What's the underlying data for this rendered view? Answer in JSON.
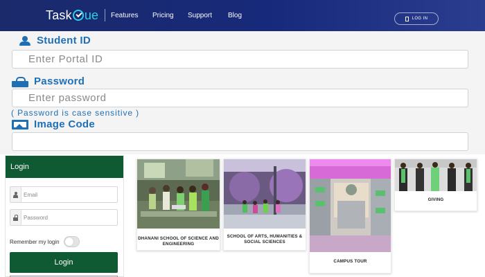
{
  "header": {
    "logo": {
      "part1": "Task",
      "part2": "ue"
    },
    "nav": [
      "Features",
      "Pricing",
      "Support",
      "Blog"
    ],
    "login_button": "LOG IN"
  },
  "portal": {
    "student_id_label": "Student ID",
    "student_id_placeholder": "Enter Portal ID",
    "password_label": "Password",
    "password_placeholder": "Enter password",
    "password_note": "( Password is case sensitive )",
    "image_code_label": "Image Code",
    "image_code_value": ""
  },
  "login_panel": {
    "title": "Login",
    "email_placeholder": "Email",
    "password_placeholder": "Password",
    "remember_label": "Remember my login",
    "remember_checked": false,
    "submit_label": "Login"
  },
  "cards": [
    {
      "caption": "DHANANI SCHOOL OF SCIENCE AND ENGINEERING"
    },
    {
      "caption": "SCHOOL OF ARTS, HUMANITIES & SOCIAL SCIENCES"
    },
    {
      "caption": "CAMPUS TOUR"
    },
    {
      "caption": "GIVING"
    }
  ],
  "colors": {
    "header_bg": "#1b2a6b",
    "accent_cyan": "#2bd0e8",
    "label_blue": "#1f6fb5",
    "login_green": "#0f5a32"
  }
}
